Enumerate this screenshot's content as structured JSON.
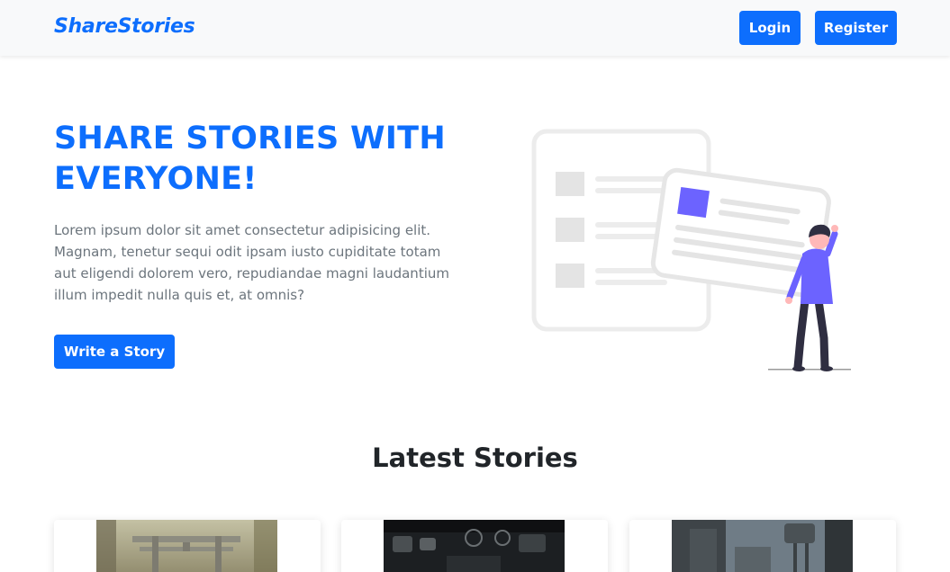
{
  "navbar": {
    "brand": "ShareStories",
    "login_label": "Login",
    "register_label": "Register"
  },
  "hero": {
    "title": "SHARE STORIES WITH EVERYONE!",
    "text": "Lorem ipsum dolor sit amet consectetur adipisicing elit. Magnam, tenetur sequi odit ipsam iusto cupiditate totam aut eligendi dolorem vero, repudiandae magni laudantium illum impedit nulla quis et, at omnis?",
    "cta_label": "Write a Story"
  },
  "latest": {
    "title": "Latest Stories",
    "cards": [
      {
        "image": "forest-torii-gate-image"
      },
      {
        "image": "dark-machinery-image"
      },
      {
        "image": "industrial-city-image"
      }
    ]
  },
  "colors": {
    "primary": "#0d6efd",
    "accent": "#6c63ff",
    "muted_text": "#6c757d",
    "navbar_bg": "#f8f9fa"
  }
}
